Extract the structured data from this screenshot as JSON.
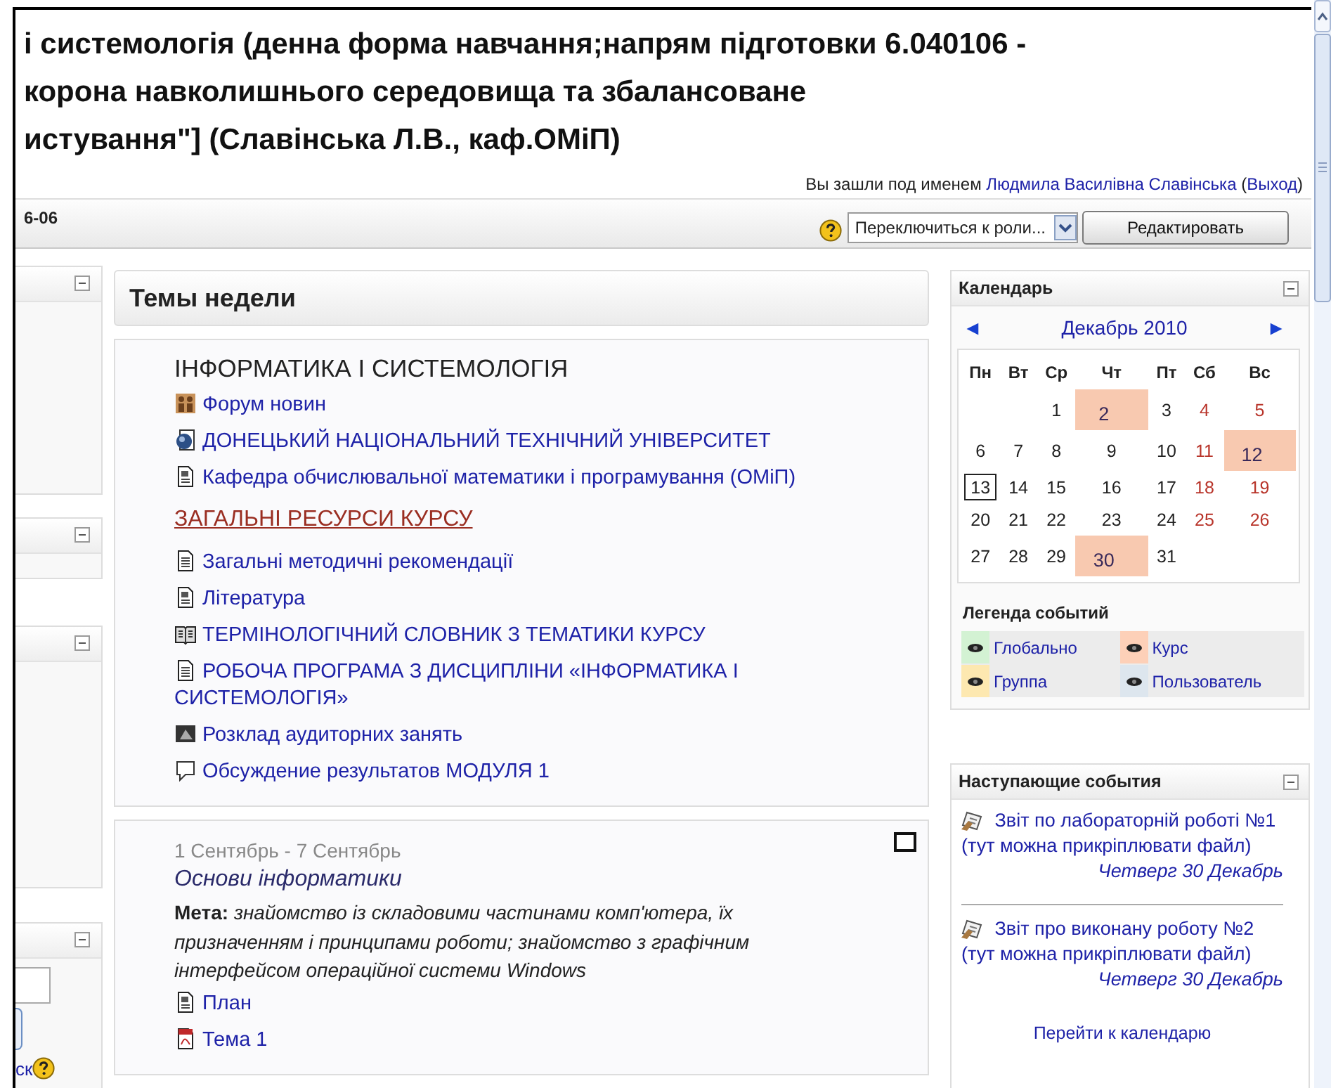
{
  "header": {
    "title_lines": [
      "і системологія (денна форма навчання;напрям підготовки 6.040106 -",
      "корона навколишнього середовища та збалансоване",
      "истування\"] (Славінська Л.В., каф.ОМіП)"
    ],
    "login": {
      "prefix": "Вы зашли под именем",
      "user": "Людмила Василівна Славінська",
      "open": "(",
      "logout": "Выход",
      "close": ")"
    }
  },
  "navbar": {
    "breadcrumb": "6-06",
    "role_select": "Переключиться к роли...",
    "edit_button": "Редактировать"
  },
  "left_blocks": [
    {
      "kind": "empty"
    },
    {
      "kind": "empty"
    },
    {
      "kind": "empty"
    },
    {
      "kind": "search",
      "link": "ск"
    }
  ],
  "main": {
    "heading": "Темы недели",
    "sections": [
      {
        "kind": "general",
        "title": "ІНФОРМАТИКА І СИСТЕМОЛОГІЯ",
        "items": [
          {
            "kind": "forum",
            "text": "Форум новин"
          },
          {
            "kind": "url",
            "text": "ДОНЕЦЬКИЙ НАЦІОНАЛЬНИЙ ТЕХНІЧНИЙ УНІВЕРСИТЕТ"
          },
          {
            "kind": "page",
            "text": "Кафедра обчислювальної математики і програмування (ОМіП)"
          },
          {
            "kind": "label",
            "text": "ЗАГАЛЬНІ РЕСУРСИ КУРСУ"
          },
          {
            "kind": "text",
            "text": "Загальні методичні рекомендації"
          },
          {
            "kind": "page",
            "text": "Література"
          },
          {
            "kind": "glossary",
            "text": "ТЕРМІНОЛОГІЧНИЙ СЛОВНИК З ТЕМАТИКИ КУРСУ"
          },
          {
            "kind": "text",
            "text": "РОБОЧА ПРОГРАМА З ДИСЦИПЛІНИ «ІНФОРМАТИКА І СИСТЕМОЛОГІЯ»"
          },
          {
            "kind": "image",
            "text": "Розклад аудиторних занять"
          },
          {
            "kind": "chat",
            "text": "Обсуждение результатов МОДУЛЯ 1"
          }
        ]
      },
      {
        "kind": "week",
        "dates": "1 Сентябрь - 7 Сентябрь",
        "title": "Основи інформатики",
        "summary": "**Мета:** *знайомство із складовими частинами комп'ютера, їх призначенням і принципами роботи; знайомство з графічним інтерфейсом операційної системи Windows*",
        "items": [
          {
            "kind": "page",
            "text": "План"
          },
          {
            "kind": "pdf",
            "text": "Тема 1"
          }
        ]
      }
    ]
  },
  "calendar": {
    "title": "Календарь",
    "prev": "◄",
    "month": "Декабрь 2010",
    "next": "►",
    "weekdays": [
      "Пн",
      "Вт",
      "Ср",
      "Чт",
      "Пт",
      "Сб",
      "Вс"
    ],
    "weeks": [
      [
        {
          "day": "1",
          "event": false,
          "today": false
        },
        {
          "day": "2",
          "event": true,
          "today": false
        },
        {
          "day": "3",
          "event": false,
          "today": false
        },
        {
          "day": "4",
          "event": false,
          "today": false
        },
        {
          "day": "5",
          "event": false,
          "today": false
        }
      ],
      [
        {
          "day": "6",
          "event": false,
          "today": false
        },
        {
          "day": "7",
          "event": false,
          "today": false
        },
        {
          "day": "8",
          "event": false,
          "today": false
        },
        {
          "day": "9",
          "event": false,
          "today": false
        },
        {
          "day": "10",
          "event": false,
          "today": false
        },
        {
          "day": "11",
          "event": false,
          "today": false
        },
        {
          "day": "12",
          "event": true,
          "today": false
        }
      ],
      [
        {
          "day": "13",
          "event": false,
          "today": true
        },
        {
          "day": "14",
          "event": false,
          "today": false
        },
        {
          "day": "15",
          "event": false,
          "today": false
        },
        {
          "day": "16",
          "event": false,
          "today": false
        },
        {
          "day": "17",
          "event": false,
          "today": false
        },
        {
          "day": "18",
          "event": false,
          "today": false
        },
        {
          "day": "19",
          "event": false,
          "today": false
        }
      ],
      [
        {
          "day": "20",
          "event": false,
          "today": false
        },
        {
          "day": "21",
          "event": false,
          "today": false
        },
        {
          "day": "22",
          "event": false,
          "today": false
        },
        {
          "day": "23",
          "event": false,
          "today": false
        },
        {
          "day": "24",
          "event": false,
          "today": false
        },
        {
          "day": "25",
          "event": false,
          "today": false
        },
        {
          "day": "26",
          "event": false,
          "today": false
        }
      ],
      [
        {
          "day": "27",
          "event": false,
          "today": false
        },
        {
          "day": "28",
          "event": false,
          "today": false
        },
        {
          "day": "29",
          "event": false,
          "today": false
        },
        {
          "day": "30",
          "event": true,
          "today": false
        },
        {
          "day": "31",
          "event": false,
          "today": false
        }
      ]
    ],
    "legend_title": "Легенда событий",
    "legend": [
      {
        "label": "Глобально",
        "color": "#d3f2d3"
      },
      {
        "label": "Курс",
        "color": "#fdd0b8"
      },
      {
        "label": "Группа",
        "color": "#fde8b0"
      },
      {
        "label": "Пользователь",
        "color": "#dde6ee"
      }
    ]
  },
  "upcoming_events": {
    "title": "Наступающие события",
    "items": [
      {
        "text": "Звіт по лабораторній роботі №1 (тут можна прикріплювати файл)",
        "date": "Четверг 30 Декабрь"
      },
      {
        "text": "Звіт про виконану роботу №2 (тут можна прикріплювати файл)",
        "date": "Четверг 30 Декабрь"
      }
    ],
    "more_link": "Перейти к календарю"
  }
}
